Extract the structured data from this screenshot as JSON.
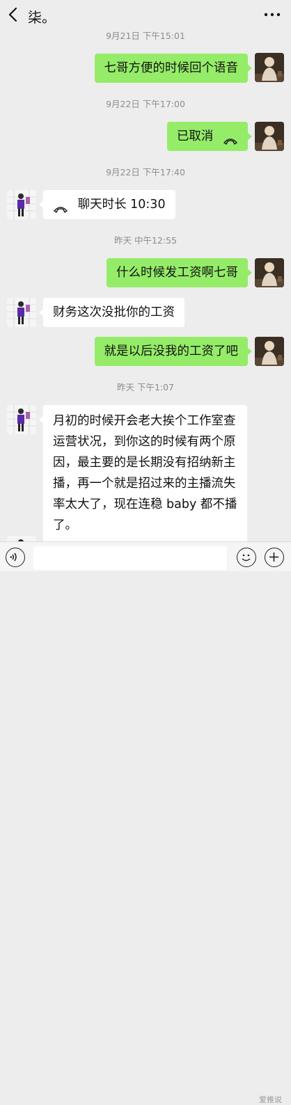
{
  "header": {
    "title": "柒。",
    "back_icon": "chevron-left-icon",
    "more_icon": "more-dots-icon"
  },
  "timestamps": {
    "t0": "9月21日 下午15:01",
    "t1": "9月22日 下午17:00",
    "t2": "9月22日 下午17:40",
    "t3": "昨天 中午12:55",
    "t4": "昨天 下午1:07"
  },
  "messages": [
    {
      "from": "me",
      "text": "七哥方便的时候回个语音"
    },
    {
      "from": "me",
      "text": "已取消",
      "icon": "phone-hangup-icon"
    },
    {
      "from": "other",
      "text": "聊天时长 10:30",
      "icon": "phone-hangup-icon"
    },
    {
      "from": "me",
      "text": "什么时候发工资啊七哥"
    },
    {
      "from": "other",
      "text": "财务这次没批你的工资"
    },
    {
      "from": "me",
      "text": "就是以后没我的工资了吧"
    },
    {
      "from": "other",
      "text": "月初的时候开会老大挨个工作室查运营状况，到你这的时候有两个原因，最主要的是长期没有招纳新主播，再一个就是招过来的主播流失率太大了，现在连稳 baby 都不播了。"
    }
  ],
  "bottom_bar": {
    "voice_icon": "voice-icon",
    "emoji_icon": "emoji-icon",
    "plus_icon": "plus-icon",
    "watermark": "爱推说"
  },
  "colors": {
    "background": "#ededed",
    "my_bubble": "#95ec69",
    "other_bubble": "#ffffff",
    "timestamp_text": "#8c8c8c"
  }
}
